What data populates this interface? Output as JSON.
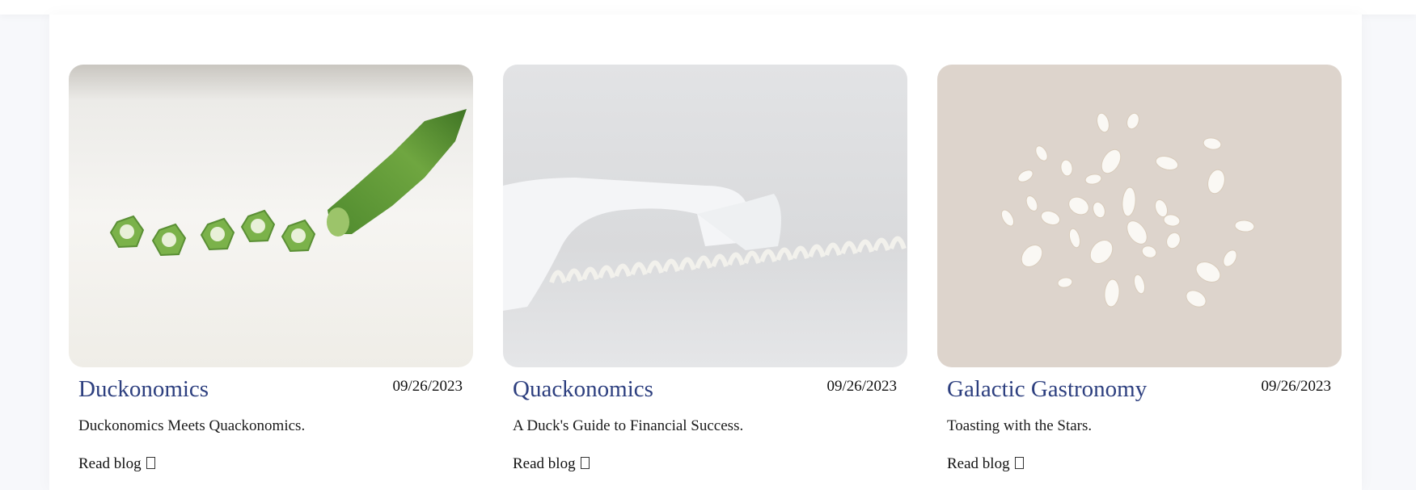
{
  "posts": [
    {
      "title": "Duckonomics",
      "date": "09/26/2023",
      "description": "Duckonomics Meets Quackonomics.",
      "link_label": "Read blog",
      "image": "okra-slices-photo"
    },
    {
      "title": "Quackonomics",
      "date": "09/26/2023",
      "description": "A Duck's Guide to Financial Success.",
      "link_label": "Read blog",
      "image": "telephone-handset-photo"
    },
    {
      "title": "Galactic Gastronomy",
      "date": "09/26/2023",
      "description": "Toasting with the Stars.",
      "link_label": "Read blog",
      "image": "cowrie-shells-photo"
    }
  ],
  "colors": {
    "title": "#2d3f7f",
    "text": "#1a1a1a",
    "background": "#f7f8fb"
  }
}
